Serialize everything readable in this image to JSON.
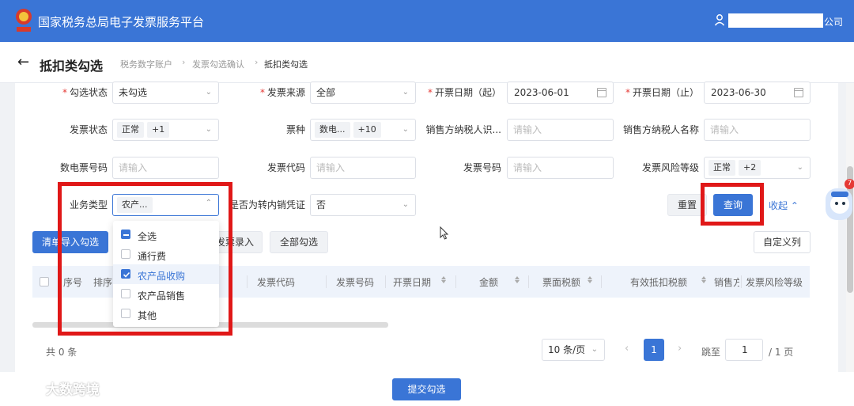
{
  "app": {
    "title": "国家税务总局电子发票服务平台",
    "company_suffix": "公司"
  },
  "page": {
    "title": "抵扣类勾选",
    "breadcrumb": [
      "税务数字账户",
      "发票勾选确认",
      "抵扣类勾选"
    ]
  },
  "filters": {
    "check_status": {
      "label": "勾选状态",
      "value": "未勾选"
    },
    "invoice_source": {
      "label": "发票来源",
      "value": "全部"
    },
    "date_start": {
      "label": "开票日期（起）",
      "value": "2023-06-01"
    },
    "date_end": {
      "label": "开票日期（止）",
      "value": "2023-06-30"
    },
    "invoice_status": {
      "label": "发票状态",
      "tag": "正常",
      "more": "+1"
    },
    "invoice_type": {
      "label": "票种",
      "tag": "数电...",
      "more": "+10"
    },
    "seller_tax_id": {
      "label": "销售方纳税人识...",
      "placeholder": "请输入"
    },
    "seller_name": {
      "label": "销售方纳税人名称",
      "placeholder": "请输入"
    },
    "digital_invoice_no": {
      "label": "数电票号码",
      "placeholder": "请输入"
    },
    "invoice_code": {
      "label": "发票代码",
      "placeholder": "请输入"
    },
    "invoice_no": {
      "label": "发票号码",
      "placeholder": "请输入"
    },
    "risk_level": {
      "label": "发票风险等级",
      "tag": "正常",
      "more": "+2"
    },
    "business_type": {
      "label": "业务类型",
      "tag": "农产..."
    },
    "internal_transfer": {
      "label": "是否为转内销凭证",
      "value": "否"
    }
  },
  "buttons": {
    "reset": "重置",
    "query": "查询",
    "collapse": "收起",
    "clear_import": "清单导入勾选",
    "batch_import_partial": "发票录入",
    "select_all": "全部勾选",
    "custom_columns": "自定义列",
    "submit": "提交勾选"
  },
  "dropdown": {
    "options": [
      {
        "label": "全选",
        "checked": "partial"
      },
      {
        "label": "通行费",
        "checked": false
      },
      {
        "label": "农产品收购",
        "checked": true
      },
      {
        "label": "农产品销售",
        "checked": false
      },
      {
        "label": "其他",
        "checked": false
      }
    ]
  },
  "table": {
    "columns": [
      "序号",
      "排序",
      "发票代码",
      "发票号码",
      "开票日期",
      "金额",
      "票面税额",
      "有效抵扣税额",
      "销售方",
      "发票风险等级"
    ]
  },
  "pagination": {
    "total": "共 0 条",
    "page_size": "10 条/页",
    "current_page": "1",
    "jump_label": "跳至",
    "jump_value": "1",
    "total_pages": "/ 1 页"
  },
  "watermark": "大数跨境",
  "badge_count": "7",
  "colors": {
    "primary": "#3a75d6",
    "highlight": "#e01818"
  }
}
